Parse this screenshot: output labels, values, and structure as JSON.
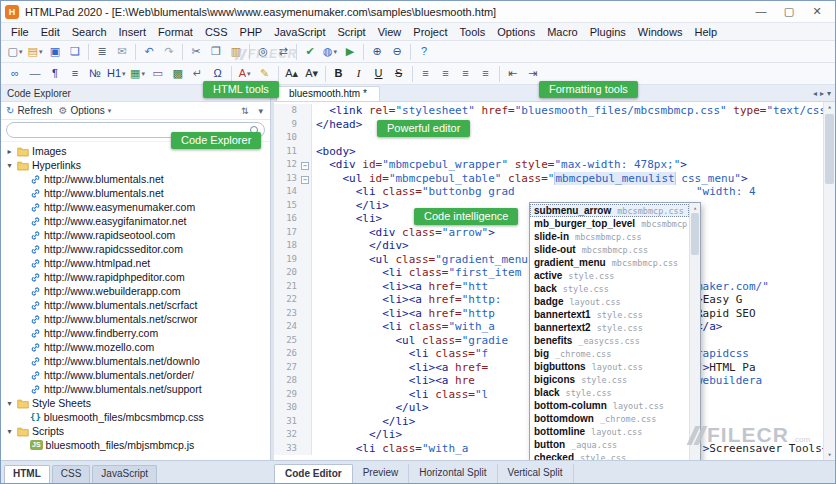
{
  "colors": {
    "accent_green": "#3fae4e",
    "link_blue": "#2f78c9",
    "folder_yellow": "#f5d06f",
    "code_navy": "#10258f"
  },
  "ui": {
    "caret_down": "▾",
    "expander_open": "▾",
    "expander_closed": "▸",
    "fold_glyph": "−",
    "scroll_up": "▴",
    "scroll_down": "▾",
    "close_glyph": "✕",
    "refresh_glyph": "↻",
    "gear_glyph": "⚙",
    "sort_glyph": "⇅"
  },
  "window": {
    "icon_letter": "H",
    "title": "HTMLPad 2020  - [E:\\Web\\blumentals\\www\\www.easymenumaker.com\\samples\\bluesmooth.htm]",
    "controls": {
      "minimize": "—",
      "maximize": "▢",
      "close": "✕"
    }
  },
  "menubar": [
    "File",
    "Edit",
    "Search",
    "Insert",
    "Format",
    "CSS",
    "PHP",
    "JavaScript",
    "Script",
    "View",
    "Project",
    "Tools",
    "Options",
    "Macro",
    "Plugins",
    "Windows",
    "Help"
  ],
  "toolbar_main": [
    {
      "name": "new-document",
      "glyph": "▢",
      "color": "#56688c",
      "caret": true
    },
    {
      "name": "open-file",
      "glyph": "▤",
      "color": "#d89a33",
      "caret": true
    },
    {
      "name": "save-file",
      "glyph": "▣",
      "color": "#2e66c9"
    },
    {
      "name": "save-all",
      "glyph": "❏",
      "color": "#2e66c9"
    },
    {
      "sep": true
    },
    {
      "name": "print",
      "glyph": "≣",
      "color": "#5a6a7e"
    },
    {
      "name": "mail",
      "glyph": "✉",
      "color": "#8a97a8"
    },
    {
      "sep": true
    },
    {
      "name": "undo",
      "glyph": "↶",
      "color": "#2e7ad1"
    },
    {
      "name": "redo",
      "glyph": "↷",
      "color": "#9aa7b8"
    },
    {
      "sep": true
    },
    {
      "name": "cut",
      "glyph": "✂",
      "color": "#56688c"
    },
    {
      "name": "copy",
      "glyph": "❐",
      "color": "#56688c"
    },
    {
      "name": "paste",
      "glyph": "▥",
      "color": "#b5832e"
    },
    {
      "sep": true
    },
    {
      "name": "find",
      "glyph": "◎",
      "color": "#34507c"
    },
    {
      "name": "replace",
      "glyph": "⇄",
      "color": "#34507c"
    },
    {
      "sep": true
    },
    {
      "name": "spell-check",
      "glyph": "✔",
      "color": "#3a9a44"
    },
    {
      "name": "browser-preview",
      "glyph": "◍",
      "color": "#2e66c9",
      "caret": true
    },
    {
      "name": "run-preview",
      "glyph": "▶",
      "color": "#3a9a44"
    },
    {
      "sep": true
    },
    {
      "name": "zoom-in",
      "glyph": "⊕",
      "color": "#34507c"
    },
    {
      "name": "zoom-out",
      "glyph": "⊖",
      "color": "#34507c"
    },
    {
      "sep": true
    },
    {
      "name": "help",
      "glyph": "?",
      "color": "#2e66c9"
    }
  ],
  "toolbar_format": [
    {
      "name": "insert-link",
      "glyph": "∞",
      "color": "#2e66c9"
    },
    {
      "name": "horizontal-rule",
      "glyph": "—",
      "color": "#5a6a7e"
    },
    {
      "name": "paragraph",
      "glyph": "¶",
      "color": "#23408f"
    },
    {
      "name": "bullet-list",
      "glyph": "≡",
      "color": "#23408f"
    },
    {
      "name": "numbered-list",
      "glyph": "№",
      "color": "#23408f"
    },
    {
      "name": "heading-1",
      "glyph": "H1",
      "color": "#23408f",
      "caret": true
    },
    {
      "name": "insert-table",
      "glyph": "▦",
      "color": "#2e8f5a",
      "caret": true
    },
    {
      "name": "insert-div",
      "glyph": "▭",
      "color": "#7a5c9e"
    },
    {
      "name": "insert-image",
      "glyph": "▩",
      "color": "#3a7a4a"
    },
    {
      "name": "line-break",
      "glyph": "↵",
      "color": "#5a6a7e"
    },
    {
      "name": "special-character",
      "glyph": "Ω",
      "color": "#23408f"
    },
    {
      "sep": true
    },
    {
      "name": "font-color",
      "glyph": "A",
      "color": "#c03030",
      "caret": true
    },
    {
      "name": "highlight",
      "glyph": "✎",
      "color": "#d8a12e"
    },
    {
      "sep": true
    },
    {
      "name": "increase-font",
      "glyph": "A▴",
      "color": "#333333"
    },
    {
      "name": "decrease-font",
      "glyph": "A▾",
      "color": "#333333"
    },
    {
      "sep": true
    },
    {
      "name": "bold",
      "glyph": "B",
      "color": "#222222",
      "style": "st-bold"
    },
    {
      "name": "italic",
      "glyph": "I",
      "color": "#222222",
      "style": "st-italic"
    },
    {
      "name": "underline",
      "glyph": "U",
      "color": "#222222",
      "style": "st-underline"
    },
    {
      "name": "strikethrough",
      "glyph": "S",
      "color": "#222222",
      "style": "st-strike"
    },
    {
      "sep": true
    },
    {
      "name": "align-left",
      "glyph": "≡",
      "color": "#44566e"
    },
    {
      "name": "align-center",
      "glyph": "≡",
      "color": "#44566e"
    },
    {
      "name": "align-right",
      "glyph": "≡",
      "color": "#44566e"
    },
    {
      "name": "justify",
      "glyph": "≡",
      "color": "#44566e"
    },
    {
      "sep": true
    },
    {
      "name": "outdent",
      "glyph": "⇤",
      "color": "#44566e"
    },
    {
      "name": "indent",
      "glyph": "⇥",
      "color": "#44566e"
    }
  ],
  "callouts": {
    "html_tools": "HTML tools",
    "formatting_tools": "Formatting tools",
    "powerful_editor": "Powerful editor",
    "code_explorer": "Code Explorer",
    "code_intelligence": "Code intelligence"
  },
  "explorer": {
    "title": "Code Explorer",
    "refresh_label": "Refresh",
    "options_label": "Options",
    "tree": [
      {
        "label": "Images",
        "icon": "folder",
        "level": 0,
        "exp": "closed"
      },
      {
        "label": "Hyperlinks",
        "icon": "folder",
        "level": 0,
        "exp": "open"
      },
      {
        "label": "http://www.blumentals.net",
        "icon": "link",
        "level": 1
      },
      {
        "label": "http://www.blumentals.net",
        "icon": "link",
        "level": 1
      },
      {
        "label": "http://www.easymenumaker.com",
        "icon": "link",
        "level": 1
      },
      {
        "label": "http://www.easygifanimator.net",
        "icon": "link",
        "level": 1
      },
      {
        "label": "http://www.rapidseotool.com",
        "icon": "link",
        "level": 1
      },
      {
        "label": "http://www.rapidcsseditor.com",
        "icon": "link",
        "level": 1
      },
      {
        "label": "http://www.htmlpad.net",
        "icon": "link",
        "level": 1
      },
      {
        "label": "http://www.rapidphpeditor.com",
        "icon": "link",
        "level": 1
      },
      {
        "label": "http://www.webuilderapp.com",
        "icon": "link",
        "level": 1
      },
      {
        "label": "http://www.blumentals.net/scrfact",
        "icon": "link",
        "level": 1
      },
      {
        "label": "http://www.blumentals.net/scrwor",
        "icon": "link",
        "level": 1
      },
      {
        "label": "http://www.findberry.com",
        "icon": "link",
        "level": 1
      },
      {
        "label": "http://www.mozello.com",
        "icon": "link",
        "level": 1
      },
      {
        "label": "http://www.blumentals.net/downlo",
        "icon": "link",
        "level": 1
      },
      {
        "label": "http://www.blumentals.net/order/",
        "icon": "link",
        "level": 1
      },
      {
        "label": "http://www.blumentals.net/support",
        "icon": "link",
        "level": 1
      },
      {
        "label": "Style Sheets",
        "icon": "folder",
        "level": 0,
        "exp": "open"
      },
      {
        "label": "bluesmooth_files/mbcsmbmcp.css",
        "icon": "css",
        "level": 1
      },
      {
        "label": "Scripts",
        "icon": "folder",
        "level": 0,
        "exp": "open"
      },
      {
        "label": "bluesmooth_files/mbjsmbmcp.js",
        "icon": "js",
        "level": 1
      }
    ]
  },
  "editor": {
    "tab_label": "bluesmooth.htm *",
    "tab_scroll_glyphs": [
      "◂",
      "▸",
      "▾"
    ],
    "bottom_tabs": [
      "Code Editor",
      "Preview",
      "Horizontal Split",
      "Vertical Split"
    ],
    "lines": [
      {
        "n": 8,
        "segs": [
          [
            "p",
            "  "
          ],
          [
            "t",
            "<link"
          ],
          [
            "a",
            " rel="
          ],
          [
            "s",
            "\"stylesheet\""
          ],
          [
            "a",
            " href="
          ],
          [
            "s",
            "\"bluesmooth_files/mbcsmbmcp.css\""
          ],
          [
            "a",
            " type="
          ],
          [
            "s",
            "\"text/css\""
          ]
        ]
      },
      {
        "n": 9,
        "segs": [
          [
            "t",
            "</head>"
          ]
        ]
      },
      {
        "n": 10,
        "segs": []
      },
      {
        "n": 11,
        "segs": [
          [
            "t",
            "<body>"
          ]
        ]
      },
      {
        "n": 12,
        "fold": true,
        "segs": [
          [
            "p",
            "  "
          ],
          [
            "t",
            "<div"
          ],
          [
            "a",
            " id="
          ],
          [
            "s",
            "\"mbmcpebul_wrapper\""
          ],
          [
            "a",
            " style="
          ],
          [
            "s",
            "\"max-width: 478px;\""
          ],
          [
            "t",
            ">"
          ]
        ]
      },
      {
        "n": 13,
        "fold": true,
        "segs": [
          [
            "p",
            "    "
          ],
          [
            "t",
            "<ul"
          ],
          [
            "a",
            " id="
          ],
          [
            "s",
            "\"mbmcpebul_table\""
          ],
          [
            "a",
            " class="
          ],
          [
            "s",
            "\""
          ],
          [
            "c",
            ""
          ],
          [
            "h",
            "mbmcpebul_menulist"
          ],
          [
            "s",
            " css_menu\""
          ],
          [
            "t",
            ">"
          ]
        ]
      },
      {
        "n": 14,
        "segs": [
          [
            "p",
            "      "
          ],
          [
            "t",
            "<li"
          ],
          [
            "a",
            " class="
          ],
          [
            "s",
            "\"buttonbg grad"
          ]
        ],
        "frag": [
          [
            "s",
            "\"width: 4"
          ]
        ]
      },
      {
        "n": 15,
        "segs": [
          [
            "p",
            "      "
          ],
          [
            "t",
            "</li>"
          ]
        ]
      },
      {
        "n": 16,
        "segs": [
          [
            "p",
            "      "
          ],
          [
            "t",
            "<li>"
          ]
        ]
      },
      {
        "n": 17,
        "segs": [
          [
            "p",
            "        "
          ],
          [
            "t",
            "<div"
          ],
          [
            "a",
            " class="
          ],
          [
            "s",
            "\"arrow\""
          ],
          [
            "t",
            ">"
          ]
        ]
      },
      {
        "n": 18,
        "segs": [
          [
            "p",
            "        "
          ],
          [
            "t",
            "</div>"
          ]
        ]
      },
      {
        "n": 19,
        "segs": [
          [
            "p",
            "        "
          ],
          [
            "t",
            "<ul"
          ],
          [
            "a",
            " class="
          ],
          [
            "s",
            "\"gradient_menu"
          ]
        ]
      },
      {
        "n": 20,
        "segs": [
          [
            "p",
            "          "
          ],
          [
            "t",
            "<li"
          ],
          [
            "a",
            " class="
          ],
          [
            "s",
            "\"first_item"
          ]
        ]
      },
      {
        "n": 21,
        "segs": [
          [
            "p",
            "          "
          ],
          [
            "t",
            "<li><a"
          ],
          [
            "a",
            " href="
          ],
          [
            "s",
            "\"htt"
          ]
        ],
        "frag": [
          [
            "s",
            "maker.com/\""
          ]
        ]
      },
      {
        "n": 22,
        "segs": [
          [
            "p",
            "          "
          ],
          [
            "t",
            "<li><a"
          ],
          [
            "a",
            " href="
          ],
          [
            "s",
            "\"http:"
          ]
        ],
        "frag": [
          [
            "t",
            ">"
          ],
          [
            "p",
            "Easy G"
          ]
        ]
      },
      {
        "n": 23,
        "segs": [
          [
            "p",
            "          "
          ],
          [
            "t",
            "<li><a"
          ],
          [
            "a",
            " href="
          ],
          [
            "s",
            "\"http"
          ]
        ],
        "frag": [
          [
            "p",
            "Rapid SEO"
          ]
        ]
      },
      {
        "n": 24,
        "segs": [
          [
            "p",
            "          "
          ],
          [
            "t",
            "<li"
          ],
          [
            "a",
            " class="
          ],
          [
            "s",
            "\"with_a"
          ]
        ],
        "frag": [
          [
            "t",
            "</a>"
          ]
        ]
      },
      {
        "n": 25,
        "segs": [
          [
            "p",
            "            "
          ],
          [
            "t",
            "<ul"
          ],
          [
            "a",
            " class="
          ],
          [
            "s",
            "\"gradie"
          ]
        ]
      },
      {
        "n": 26,
        "segs": [
          [
            "p",
            "              "
          ],
          [
            "t",
            "<li"
          ],
          [
            "a",
            " class="
          ],
          [
            "s",
            "\"f"
          ]
        ],
        "frag": [
          [
            "s",
            "rapidcss"
          ]
        ]
      },
      {
        "n": 27,
        "segs": [
          [
            "p",
            "              "
          ],
          [
            "t",
            "<li><a"
          ],
          [
            "a",
            " href="
          ]
        ],
        "frag": [
          [
            "s",
            "\""
          ],
          [
            "t",
            ">"
          ],
          [
            "p",
            "HTML Pa"
          ]
        ]
      },
      {
        "n": 28,
        "segs": [
          [
            "p",
            "              "
          ],
          [
            "t",
            "<li><a"
          ],
          [
            "a",
            " hre"
          ]
        ],
        "frag": [
          [
            "s",
            "webuildera"
          ]
        ]
      },
      {
        "n": 29,
        "segs": [
          [
            "p",
            "              "
          ],
          [
            "t",
            "<li"
          ],
          [
            "a",
            " class="
          ],
          [
            "s",
            "\"l"
          ]
        ]
      },
      {
        "n": 30,
        "segs": [
          [
            "p",
            "            "
          ],
          [
            "t",
            "</ul>"
          ]
        ]
      },
      {
        "n": 31,
        "segs": [
          [
            "p",
            "          "
          ],
          [
            "t",
            "</li>"
          ]
        ]
      },
      {
        "n": 32,
        "segs": [
          [
            "p",
            "        "
          ],
          [
            "t",
            "</li>"
          ]
        ]
      },
      {
        "n": 33,
        "segs": [
          [
            "p",
            "      "
          ],
          [
            "t",
            "<li"
          ],
          [
            "a",
            " class="
          ],
          [
            "s",
            "\"with_a"
          ]
        ],
        "frag": [
          [
            "s",
            "\""
          ],
          [
            "t",
            ">"
          ],
          [
            "p",
            "Screensaver Tools"
          ],
          [
            "t",
            "<"
          ]
        ]
      }
    ]
  },
  "autocomplete": {
    "selected_index": 0,
    "items": [
      {
        "name": "submenu_arrow",
        "file": "mbcsmbmcp.css"
      },
      {
        "name": "mb_burger_top_level",
        "file": "mbcsmbmcp.css"
      },
      {
        "name": "slide-in",
        "file": "mbcsmbmcp.css"
      },
      {
        "name": "slide-out",
        "file": "mbcsmbmcp.css"
      },
      {
        "name": "gradient_menu",
        "file": "mbcsmbmcp.css"
      },
      {
        "name": "active",
        "file": "style.css"
      },
      {
        "name": "back",
        "file": "style.css"
      },
      {
        "name": "badge",
        "file": "layout.css"
      },
      {
        "name": "bannertext1",
        "file": "style.css"
      },
      {
        "name": "bannertext2",
        "file": "style.css"
      },
      {
        "name": "benefits",
        "file": "_easycss.css"
      },
      {
        "name": "big",
        "file": "_chrome.css"
      },
      {
        "name": "bigbuttons",
        "file": "layout.css"
      },
      {
        "name": "bigicons",
        "file": "style.css"
      },
      {
        "name": "black",
        "file": "style.css"
      },
      {
        "name": "bottom-column",
        "file": "layout.css"
      },
      {
        "name": "bottomdown",
        "file": "_chrome.css"
      },
      {
        "name": "bottomline",
        "file": "layout.css"
      },
      {
        "name": "button",
        "file": "_aqua.css"
      },
      {
        "name": "checked",
        "file": "style.css"
      }
    ]
  },
  "doc_tabs": [
    "HTML",
    "CSS",
    "JavaScript"
  ],
  "watermark": {
    "brand": "FILECR",
    "suffix": ".com"
  }
}
